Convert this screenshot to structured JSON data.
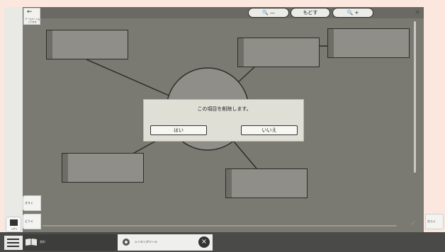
{
  "toolbar": {
    "back_arrow": "←",
    "back_label": "テーマパーへもどります",
    "zoom_out_label": "🔍 —",
    "reset_label": "もどす",
    "zoom_in_label": "🔍 +",
    "close_label": "×"
  },
  "side": {
    "record_label": "きろく",
    "tool_label": "どうぐ",
    "note_label": "ふせん",
    "open_label": "ひらく"
  },
  "dialog": {
    "message": "この項目を削除します。",
    "yes_label": "はい",
    "no_label": "いいえ"
  },
  "bottom": {
    "tabs": [
      {
        "label": "長町"
      },
      {
        "label": "シンキングツール"
      }
    ],
    "close_label": "×"
  },
  "colors": {
    "background": "#fbe7de",
    "canvas": "#7b7a72",
    "node_fill": "#8f8e88",
    "dialog": "#dfdfd6",
    "bottom_bar": "#4a4a48"
  }
}
